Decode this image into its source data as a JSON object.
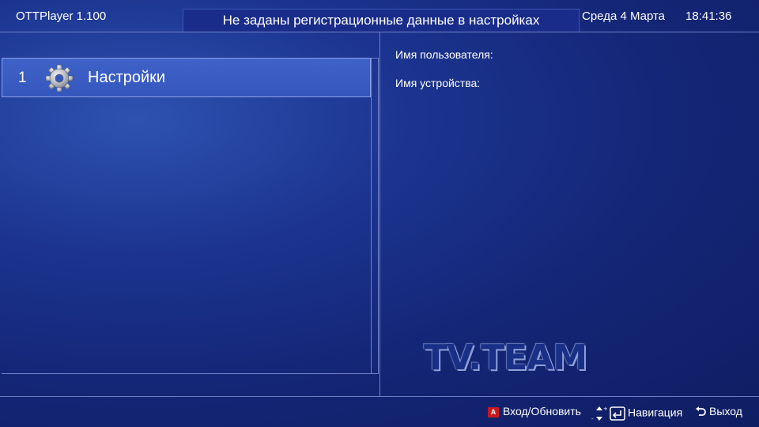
{
  "header": {
    "app_title": "OTTPlayer 1.100",
    "warning": "Не заданы регистрационные данные в настройках",
    "date": "Среда 4 Марта",
    "time": "18:41:36"
  },
  "menu": {
    "items": [
      {
        "number": "1",
        "label": "Настройки",
        "icon": "gear-icon"
      }
    ]
  },
  "details": {
    "username_label": "Имя пользователя:",
    "device_label": "Имя устройства:"
  },
  "watermark": "TV.TEAM",
  "footer": {
    "red_button_letter": "A",
    "enter_refresh": "Вход/Обновить",
    "navigation": "Навигация",
    "exit": "Выход"
  },
  "colors": {
    "background": "#142677",
    "selection": "#3a5cc4",
    "warning_bg": "#1a2c8a",
    "red_button": "#c8191e"
  }
}
